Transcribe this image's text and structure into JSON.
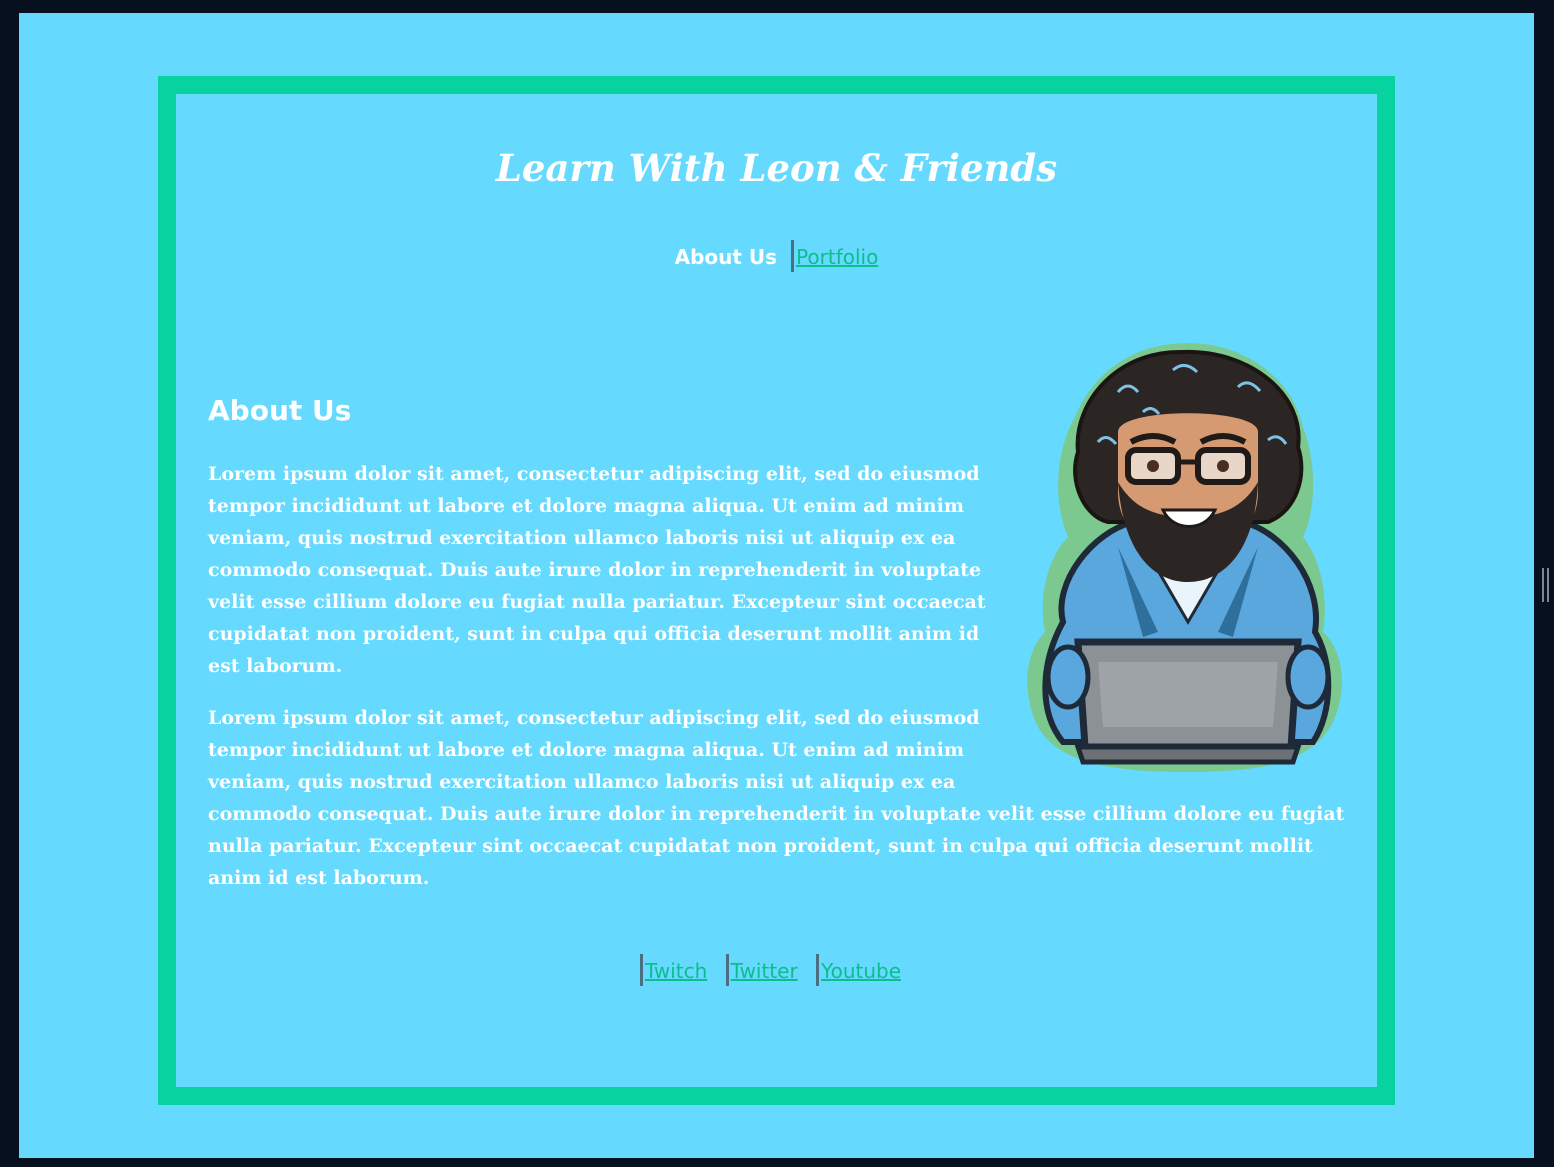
{
  "header": {
    "title": "Learn With Leon & Friends"
  },
  "nav": {
    "current": "About Us",
    "portfolio": "Portfolio"
  },
  "main": {
    "heading": "About Us",
    "paragraph_1": "Lorem ipsum dolor sit amet, consectetur adipiscing elit, sed do eiusmod tempor incididunt ut labore et dolore magna aliqua. Ut enim ad minim veniam, quis nostrud exercitation ullamco laboris nisi ut aliquip ex ea commodo consequat. Duis aute irure dolor in reprehenderit in voluptate velit esse cillium dolore eu fugiat nulla pariatur. Excepteur sint occaecat cupidatat non proident, sunt in culpa qui officia deserunt mollit anim id est laborum.",
    "paragraph_2": "Lorem ipsum dolor sit amet, consectetur adipiscing elit, sed do eiusmod tempor incididunt ut labore et dolore magna aliqua. Ut enim ad minim veniam, quis nostrud exercitation ullamco laboris nisi ut aliquip ex ea commodo consequat. Duis aute irure dolor in reprehenderit in voluptate velit esse cillium dolore eu fugiat nulla pariatur. Excepteur sint occaecat cupidatat non proident, sunt in culpa qui officia deserunt mollit anim id est laborum."
  },
  "avatar": {
    "icon": "developer-avatar-icon"
  },
  "footer": {
    "links": [
      "Twitch",
      "Twitter",
      "Youtube"
    ]
  },
  "colors": {
    "page_background": "#66d9ff",
    "frame_border": "#06d39f",
    "link": "#0bbf8c",
    "outer_background": "#07101f"
  }
}
